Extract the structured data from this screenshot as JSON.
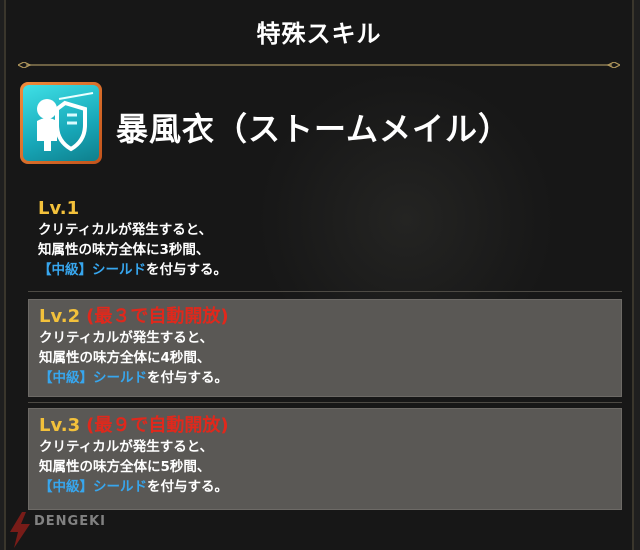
{
  "header": {
    "title": "特殊スキル"
  },
  "skill": {
    "icon": "shield-character-icon",
    "name": "暴風衣（ストームメイル）"
  },
  "levels": [
    {
      "label": "Lv.1",
      "condition": "",
      "line1": "クリティカルが発生すると、",
      "line2": "知属性の味方全体に3秒間、",
      "buff": "【中級】シールド",
      "line3_suffix": "を付与する。"
    },
    {
      "label": "Lv.2",
      "condition": "(最３で自動開放)",
      "line1": "クリティカルが発生すると、",
      "line2": "知属性の味方全体に4秒間、",
      "buff": "【中級】シールド",
      "line3_suffix": "を付与する。"
    },
    {
      "label": "Lv.3",
      "condition": "(最９で自動開放)",
      "line1": "クリティカルが発生すると、",
      "line2": "知属性の味方全体に5秒間、",
      "buff": "【中級】シールド",
      "line3_suffix": "を付与する。"
    }
  ],
  "watermark": {
    "text": "DENGEKI"
  },
  "colors": {
    "level_label": "#f3c13b",
    "condition": "#e0281c",
    "buff": "#37a6ee",
    "locked_bg": "#5a5855",
    "icon_frame": "#f08a3a",
    "icon_fill": "#3fe0e6"
  }
}
